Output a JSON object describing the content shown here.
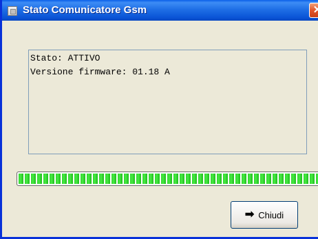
{
  "window": {
    "title": "Stato Comunicatore Gsm",
    "close_glyph": "✕",
    "icon": "app-icon"
  },
  "status": {
    "lines": [
      "Stato: ATTIVO",
      "Versione firmware: 01.18 A"
    ]
  },
  "progress": {
    "value_fraction": 1.0
  },
  "buttons": {
    "close_label": "Chiudi",
    "close_icon": "arrow-right-icon",
    "close_icon_glyph": "➡"
  },
  "colors": {
    "titlebar": "#1f6fe6",
    "window_bg": "#ece9d8",
    "progress_fill": "#2ed62a"
  }
}
